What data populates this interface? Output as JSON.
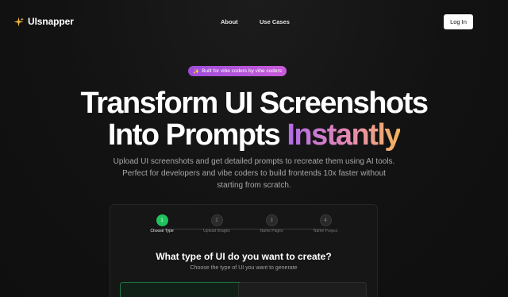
{
  "brand": {
    "name": "UIsnapper",
    "icon": "sparkle-icon",
    "accent": "#f2b63c"
  },
  "nav": {
    "links": [
      "About",
      "Use Cases"
    ],
    "login_label": "Log In"
  },
  "badge": {
    "icon": "sparkles-icon",
    "text": "Built for vibe coders by vibe coders"
  },
  "hero": {
    "line1": "Transform UI Screenshots",
    "line2_plain": "Into Prompts",
    "line2_gradient": "Instantly",
    "subtext": "Upload UI screenshots and get detailed prompts to recreate them using AI tools. Perfect for developers and vibe coders to build frontends 10x faster without starting from scratch."
  },
  "wizard": {
    "steps": [
      {
        "number": "1",
        "label": "Choose Type",
        "active": true
      },
      {
        "number": "2",
        "label": "Upload Images",
        "active": false
      },
      {
        "number": "3",
        "label": "Name Pages",
        "active": false
      },
      {
        "number": "4",
        "label": "Name Project",
        "active": false
      }
    ],
    "question": "What type of UI do you want to create?",
    "subquestion": "Choose the type of UI you want to generate"
  },
  "colors": {
    "active_step": "#1fc25c",
    "badge_gradient_start": "#9d4ddb",
    "badge_gradient_end": "#c85bd8"
  }
}
